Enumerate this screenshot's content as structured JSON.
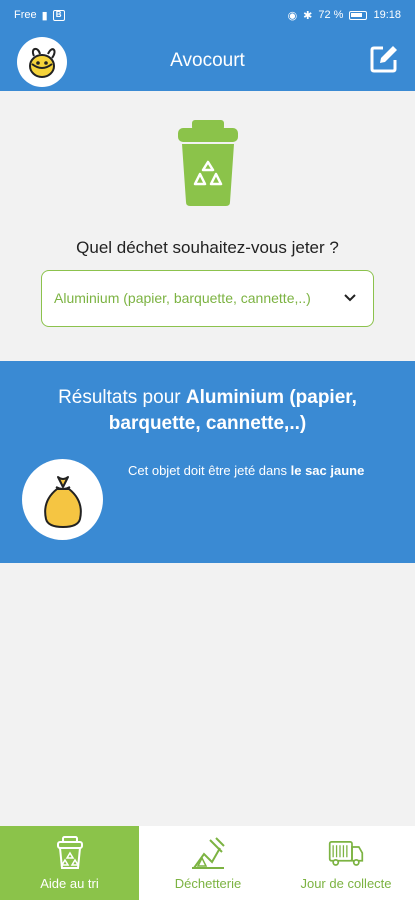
{
  "status_bar": {
    "carrier": "Free",
    "app_badge": "B",
    "battery_percent": "72 %",
    "time": "19:18"
  },
  "app_bar": {
    "title": "Avocourt",
    "logo_icon": "bee-logo-icon",
    "edit_icon": "edit-icon"
  },
  "search": {
    "question": "Quel déchet souhaitez-vous jeter ?",
    "selected_value": "Aluminium (papier, barquette, cannette,..)"
  },
  "results": {
    "heading_prefix": "Résultats pour ",
    "heading_item": "Aluminium (papier, barquette, cannette,..)",
    "desc_prefix": "Cet objet doit être jeté dans ",
    "desc_bin": "le sac jaune",
    "bag_color": "#f5c542"
  },
  "tabs": [
    {
      "label": "Aide au tri",
      "icon": "recycle-bin-icon",
      "active": true
    },
    {
      "label": "Déchetterie",
      "icon": "recycling-center-icon",
      "active": false
    },
    {
      "label": "Jour de collecte",
      "icon": "garbage-truck-icon",
      "active": false
    }
  ],
  "colors": {
    "primary_blue": "#3a8ad3",
    "accent_green": "#8bc34a",
    "text_green": "#7cb342"
  }
}
